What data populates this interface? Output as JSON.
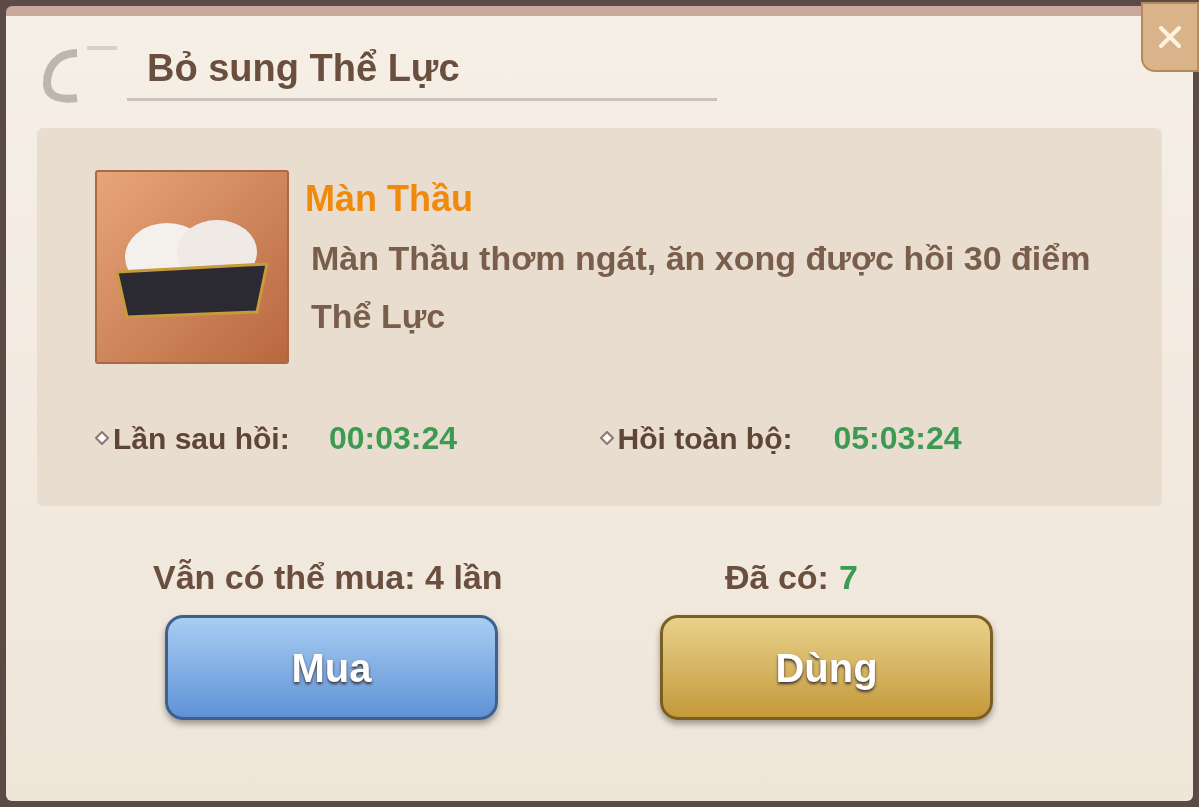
{
  "title": "Bỏ sung Thể Lực",
  "item": {
    "name": "Màn Thầu",
    "description": "Màn Thầu thơm ngát, ăn xong được hồi 30 điểm Thể Lực"
  },
  "timers": [
    {
      "label": "Lần sau hồi:",
      "value": "00:03:24"
    },
    {
      "label": "Hồi toàn bộ:",
      "value": "05:03:24"
    }
  ],
  "purchases_left": "Vẫn có thể mua: 4 lần",
  "owned": {
    "label": "Đã có:",
    "value": "7"
  },
  "buttons": [
    {
      "label": "Mua",
      "kind": "blue"
    },
    {
      "label": "Dùng",
      "kind": "gold"
    }
  ]
}
